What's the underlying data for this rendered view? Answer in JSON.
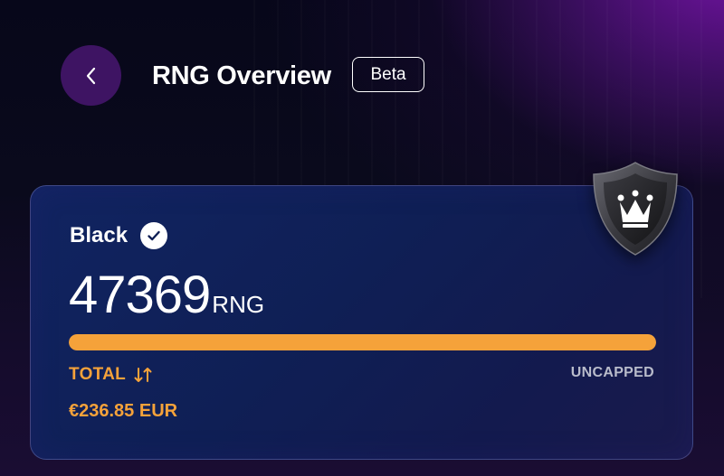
{
  "header": {
    "title": "RNG Overview",
    "badge": "Beta"
  },
  "card": {
    "tier": "Black",
    "amount": "47369",
    "unit": "RNG",
    "progress": 1.0,
    "total_label": "TOTAL",
    "cap_status": "UNCAPPED",
    "fiat_value": "€236.85 EUR"
  },
  "icons": {
    "back": "chevron-left-icon",
    "verified": "check-circle-icon",
    "sort": "sort-arrows-icon",
    "badge": "shield-crown-icon"
  },
  "colors": {
    "accent": "#f5a23a",
    "back_button": "#3e1463",
    "card_bg": "#0f1f55",
    "muted_text": "#b9bccb"
  }
}
